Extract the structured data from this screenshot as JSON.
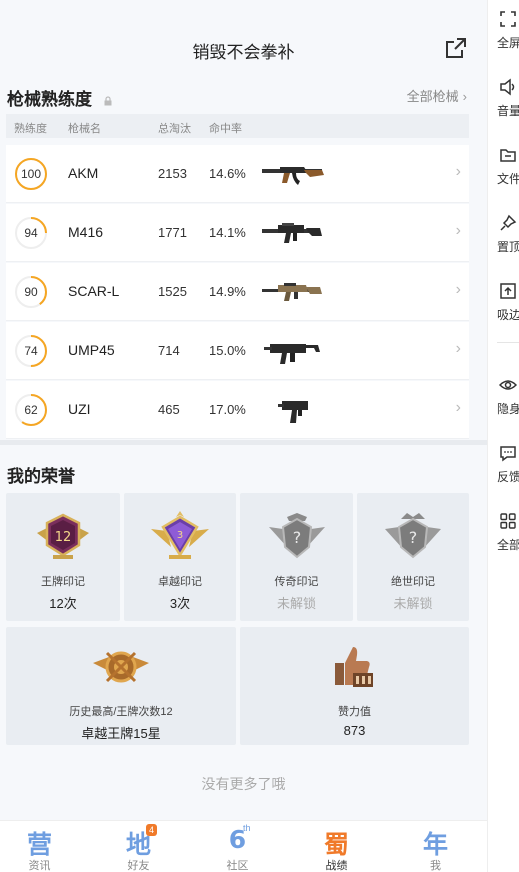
{
  "header": {
    "title": "销毁不会拳补"
  },
  "mastery": {
    "title": "枪械熟练度",
    "all_label": "全部枪械",
    "columns": [
      "熟练度",
      "枪械名",
      "总淘汰",
      "命中率"
    ],
    "guns": [
      {
        "level": "100",
        "progress": 1.0,
        "name": "AKM",
        "kills": "2153",
        "accuracy": "14.6%"
      },
      {
        "level": "94",
        "progress": 0.25,
        "name": "M416",
        "kills": "1771",
        "accuracy": "14.1%"
      },
      {
        "level": "90",
        "progress": 0.4,
        "name": "SCAR-L",
        "kills": "1525",
        "accuracy": "14.9%"
      },
      {
        "level": "74",
        "progress": 0.5,
        "name": "UMP45",
        "kills": "714",
        "accuracy": "15.0%"
      },
      {
        "level": "62",
        "progress": 0.6,
        "name": "UZI",
        "kills": "465",
        "accuracy": "17.0%"
      }
    ]
  },
  "honors": {
    "title": "我的荣誉",
    "cards": [
      {
        "label": "王牌印记",
        "value": "12次",
        "badge_text": "12",
        "locked": false
      },
      {
        "label": "卓越印记",
        "value": "3次",
        "badge_text": "3",
        "locked": false
      },
      {
        "label": "传奇印记",
        "value": "未解锁",
        "badge_text": "?",
        "locked": true
      },
      {
        "label": "绝世印记",
        "value": "未解锁",
        "badge_text": "?",
        "locked": true
      }
    ],
    "wide_cards": [
      {
        "label": "历史最高/王牌次数12",
        "value": "卓越王牌15星"
      },
      {
        "label": "赞力值",
        "value": "873"
      }
    ]
  },
  "no_more": "没有更多了哦",
  "tabs": [
    {
      "icon_text": "营",
      "label": "资讯",
      "active": false
    },
    {
      "icon_text": "地",
      "label": "好友",
      "badge": "4",
      "active": false
    },
    {
      "icon_text": "6",
      "sup": "th",
      "label": "社区",
      "active": false
    },
    {
      "icon_text": "蜀",
      "label": "战绩",
      "active": true
    },
    {
      "icon_text": "年",
      "label": "我",
      "active": false
    }
  ],
  "side_menu": [
    {
      "icon": "fullscreen-icon",
      "label": "全屏"
    },
    {
      "icon": "volume-icon",
      "label": "音量"
    },
    {
      "icon": "folder-icon",
      "label": "文件"
    },
    {
      "icon": "pin-icon",
      "label": "置顶"
    },
    {
      "icon": "snap-edge-icon",
      "label": "吸边"
    },
    {
      "icon": "eye-icon",
      "label": "隐身"
    },
    {
      "icon": "feedback-icon",
      "label": "反馈"
    },
    {
      "icon": "grid-icon",
      "label": "全部"
    }
  ],
  "colors": {
    "accent": "#f5a623",
    "tab_blue": "#6f9ee0",
    "badge_orange": "#f07a2a"
  }
}
